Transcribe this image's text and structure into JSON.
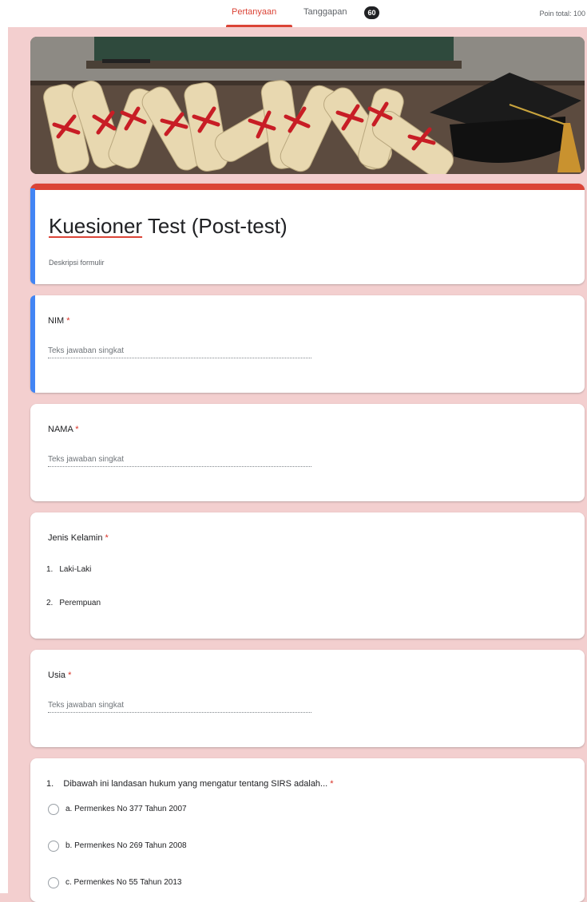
{
  "topbar": {
    "tab_questions": "Pertanyaan",
    "tab_responses": "Tanggapan",
    "responses_count": "60",
    "total_points": "Poin total: 100"
  },
  "form": {
    "title_first": "Kuesioner",
    "title_rest": " Test (Post-test)",
    "description": "Deskripsi formulir"
  },
  "questions": [
    {
      "label": "NIM",
      "placeholder": "Teks jawaban singkat"
    },
    {
      "label": "NAMA",
      "placeholder": "Teks jawaban singkat"
    },
    {
      "label": "Jenis Kelamin",
      "options": [
        {
          "num": "1.",
          "text": "Laki-Laki"
        },
        {
          "num": "2.",
          "text": "Perempuan"
        }
      ]
    },
    {
      "label": "Usia",
      "placeholder": "Teks jawaban singkat"
    },
    {
      "label": "1.    Dibawah ini landasan hukum yang mengatur tentang SIRS adalah...",
      "options": [
        "a. Permenkes No 377 Tahun 2007",
        "b. Permenkes No 269 Tahun 2008",
        "c. Permenkes No 55 Tahun 2013"
      ]
    }
  ],
  "required_mark": "*",
  "colors": {
    "accent": "#db4437",
    "active": "#4285f4",
    "background": "#f3cfcf"
  }
}
